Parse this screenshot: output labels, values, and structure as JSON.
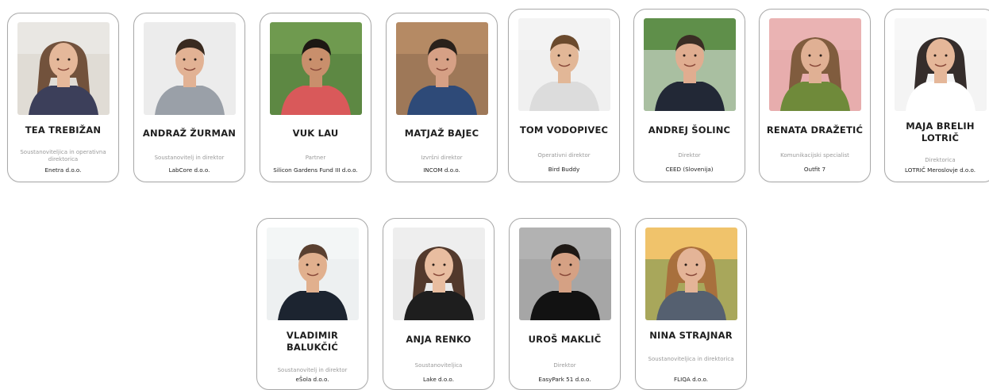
{
  "people": [
    {
      "name": "TEA TREBIŽAN",
      "role": "Soustanoviteljica in operativna direktorica",
      "company": "Enetra d.o.o."
    },
    {
      "name": "ANDRAŽ ŽURMAN",
      "role": "Soustanovitelj in direktor",
      "company": "LabCore d.o.o."
    },
    {
      "name": "VUK LAU",
      "role": "Partner",
      "company": "Silicon Gardens Fund III d.o.o."
    },
    {
      "name": "MATJAŽ BAJEC",
      "role": "Izvršni direktor",
      "company": "INCOM d.o.o."
    },
    {
      "name": "TOM VODOPIVEC",
      "role": "Operativni direktor",
      "company": "Bird Buddy"
    },
    {
      "name": "ANDREJ ŠOLINC",
      "role": "Direktor",
      "company": "CEED (Slovenija)"
    },
    {
      "name": "RENATA DRAŽETIĆ",
      "role": "Komunikacijski specialist",
      "company": "Outfit 7"
    },
    {
      "name": "MAJA BRELIH LOTRIČ",
      "role": "Direktorica",
      "company": "LOTRIČ Meroslovje d.o.o."
    },
    {
      "name": "VLADIMIR BALUKČIĆ",
      "role": "Soustanovitelj in direktor",
      "company": "eŠola d.o.o."
    },
    {
      "name": "ANJA RENKO",
      "role": "Soustanoviteljica",
      "company": "Lake d.o.o."
    },
    {
      "name": "UROŠ MAKLIČ",
      "role": "Direktor",
      "company": "EasyPark 51 d.o.o."
    },
    {
      "name": "NINA STRAJNAR",
      "role": "Soustanoviteljica in direktorica",
      "company": "FLIQA d.o.o."
    }
  ],
  "colors": {
    "card_border": "#a9a9a9",
    "name_text": "#1e1e1e",
    "role_text": "#9a9a9a",
    "company_text": "#222222"
  },
  "icons": [
    "person-photo"
  ]
}
